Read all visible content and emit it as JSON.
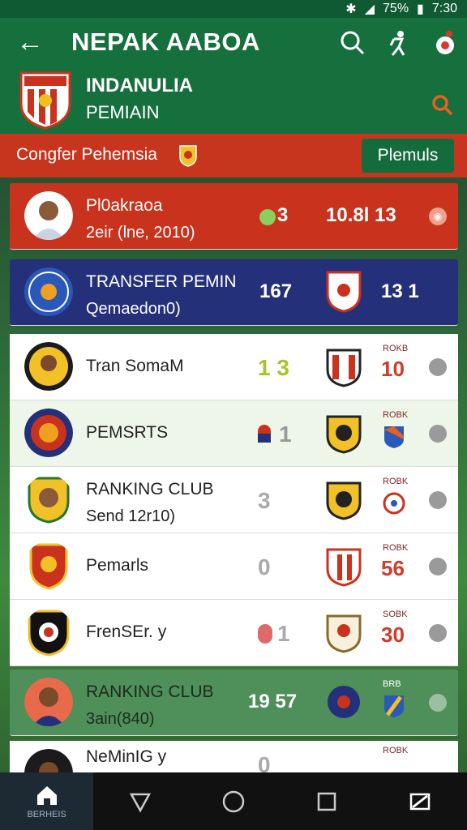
{
  "status": {
    "time": "7:30",
    "battery": "75%"
  },
  "header": {
    "title": "NEPAK AABOA",
    "club_name": "INDANULIA",
    "club_sub": "PEMIAIN"
  },
  "banner": {
    "text": "Congfer Pehemsia",
    "button": "Plemuls"
  },
  "rows": [
    {
      "name": "Pl0akraoa",
      "sub": "2eir (lne, 2010)",
      "score": "3",
      "right": "10.8l 13",
      "style": "red"
    },
    {
      "name": "TRANSFER PEMIN",
      "sub": "Qemaedon0)",
      "score": "167",
      "right": "13  1",
      "style": "navy"
    },
    {
      "name": "Tran SomaM",
      "sub": "",
      "score": "1 3",
      "rank_label": "ROKB",
      "rank": "10",
      "style": "white"
    },
    {
      "name": "PEMSRTS",
      "sub": "",
      "score": "1",
      "rank_label": "ROBK",
      "rank": "",
      "style": "light"
    },
    {
      "name": "RANKING CLUB",
      "sub": "Send 12r10)",
      "score": "3",
      "rank_label": "ROBK",
      "rank": "",
      "style": "white"
    },
    {
      "name": "Pemarls",
      "sub": "",
      "score": "0",
      "rank_label": "ROBK",
      "rank": "56",
      "style": "white"
    },
    {
      "name": "FrenSEr. y",
      "sub": "",
      "score": "1",
      "rank_label": "SOBK",
      "rank": "30",
      "style": "white"
    },
    {
      "name": "RANKING CLUB",
      "sub": "3ain(840)",
      "score": "19  57",
      "rank_label": "BRB",
      "rank": "",
      "style": "green"
    },
    {
      "name": "NeMinIG y",
      "sub": "",
      "score": "0",
      "rank_label": "ROBK",
      "rank": "",
      "style": "white"
    }
  ],
  "bottom_nav": {
    "home_label": "BERHEIS"
  }
}
